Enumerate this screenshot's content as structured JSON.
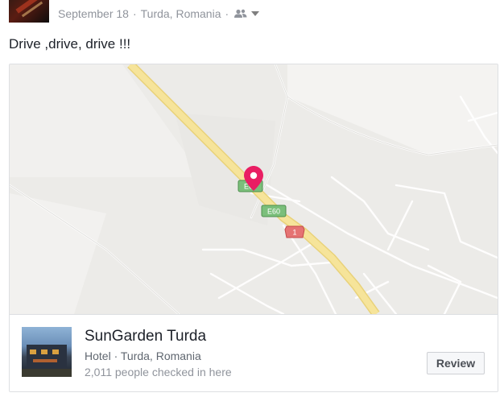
{
  "post": {
    "date": "September 18",
    "separator": "·",
    "location": "Turda, Romania",
    "audience_icon": "friends-icon",
    "caret_icon": "chevron-down-icon",
    "text": "Drive ,drive, drive !!!"
  },
  "map": {
    "road_shields": [
      "E60",
      "E60",
      "1"
    ],
    "pin_color": "#e91e63",
    "highway_color": "#f6e49a",
    "shield_green": "#7bbf7b",
    "shield_red": "#e57373"
  },
  "place": {
    "name": "SunGarden Turda",
    "category": "Hotel · Turda, Romania",
    "checkins": "2,011 people checked in here",
    "review_label": "Review"
  }
}
